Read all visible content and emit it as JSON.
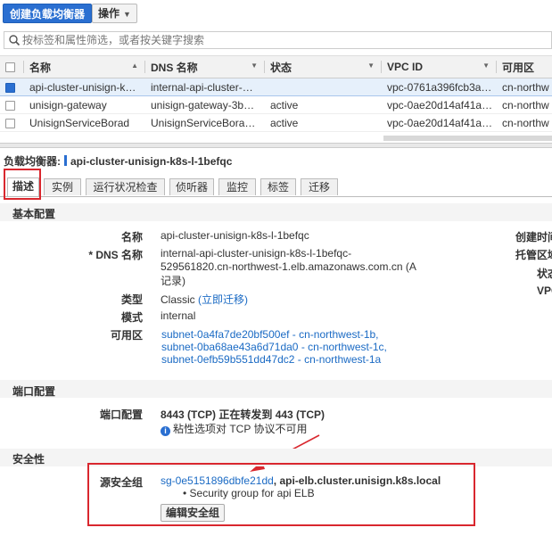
{
  "toolbar": {
    "create_label": "创建负载均衡器",
    "actions_label": "操作"
  },
  "filter": {
    "placeholder": "按标签和属性筛选，或者按关键字搜索"
  },
  "table": {
    "columns": [
      "名称",
      "DNS 名称",
      "状态",
      "VPC ID",
      "可用区"
    ],
    "rows": [
      {
        "name": "api-cluster-unisign-k…",
        "dns": "internal-api-cluster-…",
        "status": "",
        "vpc": "vpc-0761a396fcb3a…",
        "az": "cn-northw",
        "selected": true
      },
      {
        "name": "unisign-gateway",
        "dns": "unisign-gateway-3b…",
        "status": "active",
        "vpc": "vpc-0ae20d14af41a…",
        "az": "cn-northw",
        "selected": false
      },
      {
        "name": "UnisignServiceBorad",
        "dns": "UnisignServiceBora…",
        "status": "active",
        "vpc": "vpc-0ae20d14af41a…",
        "az": "cn-northw",
        "selected": false
      }
    ]
  },
  "detail": {
    "header_label": "负载均衡器:",
    "header_name": "api-cluster-unisign-k8s-l-1befqc",
    "tabs": [
      "描述",
      "实例",
      "运行状况检查",
      "侦听器",
      "监控",
      "标签",
      "迁移"
    ],
    "basic": {
      "title": "基本配置",
      "name_label": "名称",
      "name_value": "api-cluster-unisign-k8s-l-1befqc",
      "dns_label": "* DNS 名称",
      "dns_line1": "internal-api-cluster-unisign-k8s-l-1befqc-",
      "dns_line2": "529561820.cn-northwest-1.elb.amazonaws.com.cn (A",
      "dns_line3": "记录)",
      "type_label": "类型",
      "type_value": "Classic",
      "type_link": "(立即迁移)",
      "mode_label": "模式",
      "mode_value": "internal",
      "az_label": "可用区",
      "subnets": [
        "subnet-0a4fa7de20bf500ef - cn-northwest-1b,",
        "subnet-0ba68ae43a6d71da0 - cn-northwest-1c,",
        "subnet-0efb59b551dd47dc2 - cn-northwest-1a"
      ],
      "right_labels": [
        "创建时间",
        "托管区域",
        "状态",
        "VPC"
      ]
    },
    "port": {
      "title": "端口配置",
      "label": "端口配置",
      "value": "8443 (TCP) 正在转发到 443 (TCP)",
      "note": "粘性选项对 TCP 协议不可用"
    },
    "security": {
      "title": "安全性",
      "label": "源安全组",
      "sg_id": "sg-0e5151896dbfe21dd",
      "sg_name": ", api-elb.cluster.unisign.k8s.local",
      "sg_desc": "• Security group for api ELB",
      "edit_label": "编辑安全组"
    }
  },
  "colors": {
    "accent": "#2a6fd1",
    "link": "#1a6ac4",
    "highlight": "#d9272e"
  }
}
